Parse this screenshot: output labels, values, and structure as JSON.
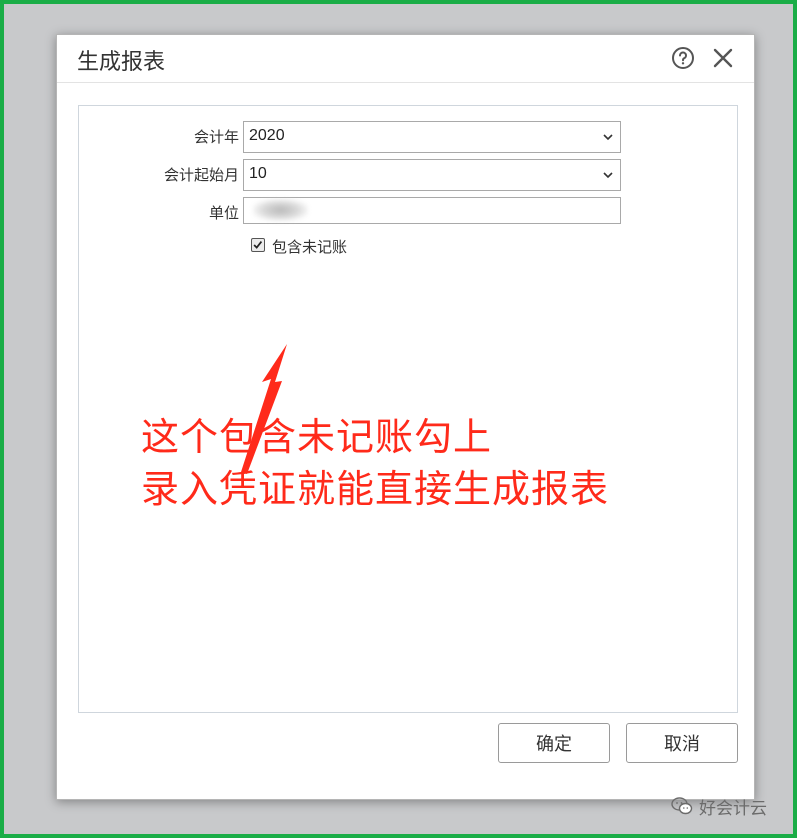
{
  "dialog": {
    "title": "生成报表",
    "help_icon": "help-icon",
    "close_icon": "close-icon"
  },
  "form": {
    "year_label": "会计年",
    "year_value": "2020",
    "start_month_label": "会计起始月",
    "start_month_value": "10",
    "unit_label": "单位",
    "unit_value": "",
    "include_unposted_label": "包含未记账",
    "include_unposted_checked": true
  },
  "annotation": {
    "line1": "这个包含未记账勾上",
    "line2": "录入凭证就能直接生成报表",
    "color": "#ff2a1a"
  },
  "buttons": {
    "ok": "确定",
    "cancel": "取消"
  },
  "watermark": {
    "icon": "wechat-icon",
    "text": "好会计云"
  },
  "colors": {
    "frame_border": "#1aad47",
    "backdrop": "#c8c9cb"
  }
}
